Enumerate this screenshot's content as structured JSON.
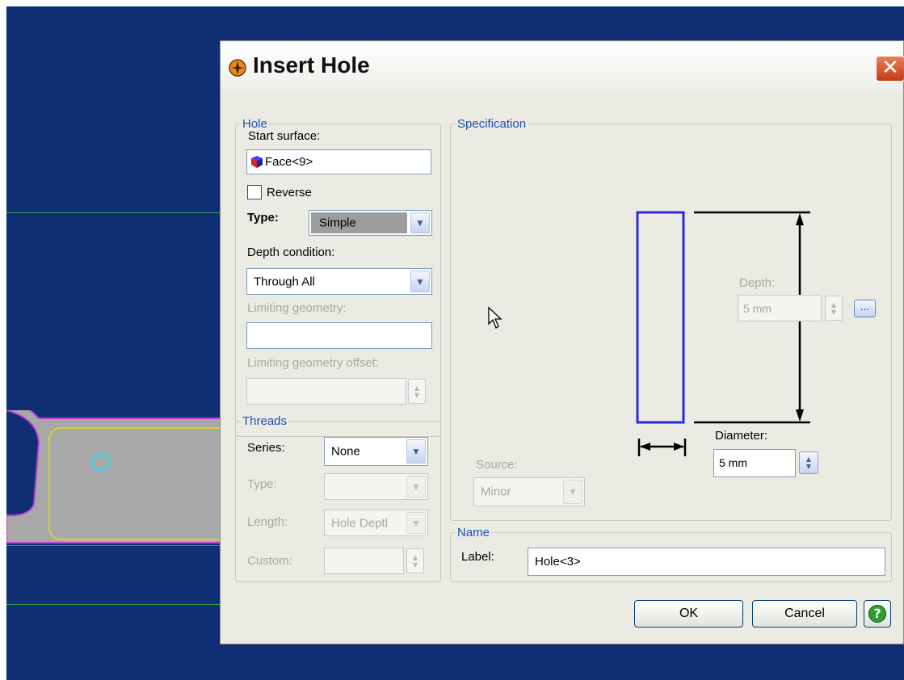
{
  "dialog": {
    "title": "Insert Hole",
    "close_symbol": "✕",
    "ok_label": "OK",
    "cancel_label": "Cancel",
    "help_symbol": "?"
  },
  "hole": {
    "legend": "Hole",
    "start_surface_label": "Start surface:",
    "start_surface_value": "Face<9>",
    "reverse_label": "Reverse",
    "reverse_checked": false,
    "type_label": "Type:",
    "type_value": "Simple",
    "depth_condition_label": "Depth condition:",
    "depth_condition_value": "Through All",
    "limiting_geometry_label": "Limiting geometry:",
    "limiting_geometry_value": "",
    "limiting_offset_label": "Limiting geometry offset:",
    "limiting_offset_value": ""
  },
  "threads": {
    "legend": "Threads",
    "series_label": "Series:",
    "series_value": "None",
    "type_label": "Type:",
    "type_value": "",
    "length_label": "Length:",
    "length_value": "Hole Deptl",
    "custom_label": "Custom:",
    "custom_value": ""
  },
  "specification": {
    "legend": "Specification",
    "depth_label": "Depth:",
    "depth_value": "5 mm",
    "depth_more_label": "...",
    "diameter_label": "Diameter:",
    "diameter_value": "5 mm",
    "source_label": "Source:",
    "source_value": "Minor"
  },
  "name": {
    "legend": "Name",
    "label_label": "Label:",
    "label_value": "Hole<3>"
  },
  "colors": {
    "viewport_bg": "#0f2e73",
    "hole_outline": "#2a2ae0",
    "legend_text": "#1f4fb6",
    "close_button": "#d2522a",
    "help_button": "#2e9e2e"
  },
  "icons": {
    "title": "part-gear-icon",
    "start_surface": "face-cube-icon",
    "cursor": "mouse-pointer-icon",
    "help": "help-icon"
  }
}
